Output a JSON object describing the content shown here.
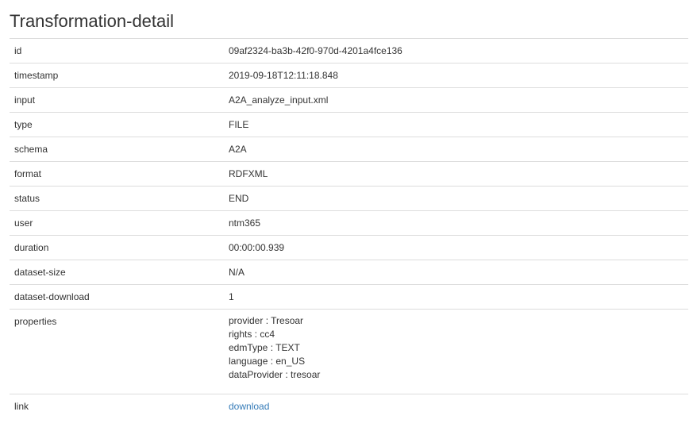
{
  "page": {
    "title": "Transformation-detail"
  },
  "rows": {
    "id": {
      "label": "id",
      "value": "09af2324-ba3b-42f0-970d-4201a4fce136"
    },
    "timestamp": {
      "label": "timestamp",
      "value": "2019-09-18T12:11:18.848"
    },
    "input": {
      "label": "input",
      "value": "A2A_analyze_input.xml"
    },
    "type": {
      "label": "type",
      "value": "FILE"
    },
    "schema": {
      "label": "schema",
      "value": "A2A"
    },
    "format": {
      "label": "format",
      "value": "RDFXML"
    },
    "status": {
      "label": "status",
      "value": "END"
    },
    "user": {
      "label": "user",
      "value": "ntm365"
    },
    "duration": {
      "label": "duration",
      "value": "00:00:00.939"
    },
    "dataset_size": {
      "label": "dataset-size",
      "value": "N/A"
    },
    "dataset_download": {
      "label": "dataset-download",
      "value": "1"
    },
    "properties": {
      "label": "properties",
      "items": [
        "provider : Tresoar",
        "rights : cc4",
        "edmType : TEXT",
        "language : en_US",
        "dataProvider : tresoar"
      ]
    },
    "link": {
      "label": "link",
      "value": "download"
    }
  },
  "colors": {
    "text": "#333333",
    "border": "#dddddd",
    "link": "#337ab7"
  }
}
